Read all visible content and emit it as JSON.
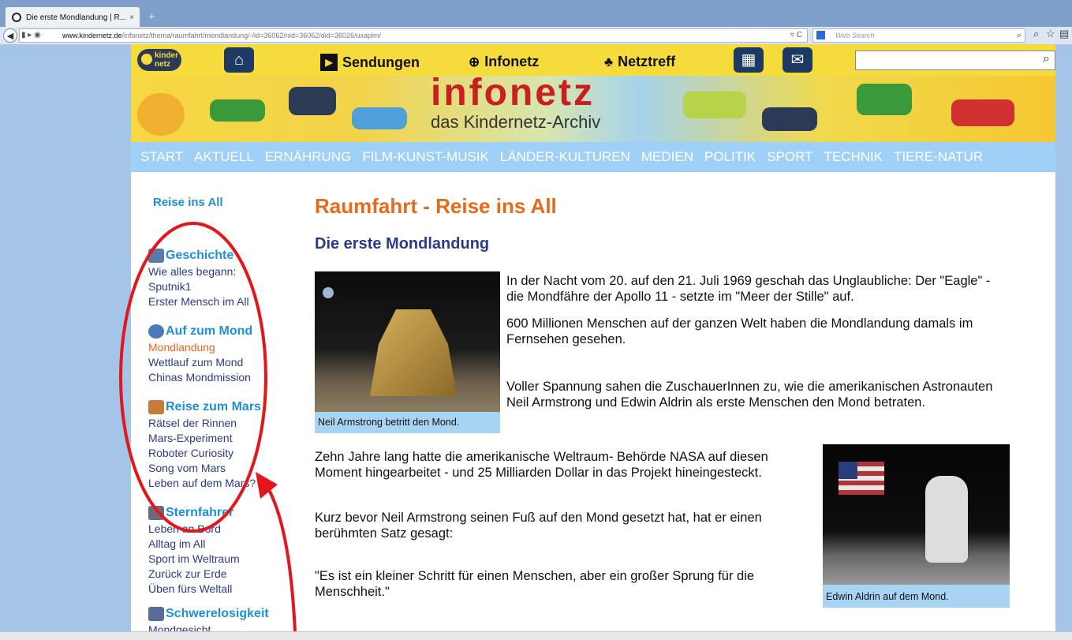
{
  "browser": {
    "tab_title": "Die erste Mondlandung | R...",
    "tab_close": "×",
    "new_tab": "+",
    "url_site": "◀ ▮ ▸",
    "url_domain": "www.kindernetz.de",
    "url_path": "/infonetz/thema/raumfahrt/mondlandung/-/id=36062/nid=36062/did=36026/uxaplm/",
    "reload_icon": "▿ C",
    "search_placeholder": "Web Search"
  },
  "site": {
    "logo": "kinder netz",
    "nav": {
      "sendungen": "Sendungen",
      "infonetz": "Infonetz",
      "netztreff": "Netztreff"
    },
    "banner_title": "infonetz",
    "banner_subtitle": "das Kindernetz-Archiv",
    "categories": [
      "START",
      "AKTUELL",
      "ERNÄHRUNG",
      "FILM-KUNST-MUSIK",
      "LÄNDER-KULTUREN",
      "MEDIEN",
      "POLITIK",
      "SPORT",
      "TECHNIK",
      "TIERE-NATUR"
    ]
  },
  "sidebar": {
    "heading": "Reise ins All",
    "groups": [
      {
        "title": "Geschichte",
        "items": [
          "Wie alles begann:",
          "Sputnik1",
          "Erster Mensch im All"
        ]
      },
      {
        "title": "Auf zum Mond",
        "items": [
          "Mondlandung",
          "Wettlauf zum Mond",
          "Chinas Mondmission"
        ]
      },
      {
        "title": "Reise zum Mars",
        "items": [
          "Rätsel der Rinnen",
          "Mars-Experiment",
          "Roboter Curiosity",
          "Song vom Mars",
          "Leben auf dem Mars?"
        ]
      },
      {
        "title": "Sternfahrer",
        "items": [
          "Leben an Bord",
          "Alltag im All",
          "Sport im Weltraum",
          "Zurück zur Erde",
          "Üben fürs Weltall"
        ]
      },
      {
        "title": "Schwerelosigkeit",
        "items": [
          "Mondgesicht"
        ]
      }
    ]
  },
  "content": {
    "title": "Raumfahrt - Reise ins All",
    "subtitle": "Die erste Mondlandung",
    "p1": "In der Nacht vom 20. auf den 21. Juli 1969 geschah das Unglaubliche: Der \"Eagle\" - die Mondfähre der Apollo 11 - setzte im \"Meer der Stille\" auf.",
    "p2": "600 Millionen Menschen auf der ganzen Welt haben die Mondlandung damals im Fernsehen gesehen.",
    "p3": "Voller Spannung sahen die ZuschauerInnen zu, wie die amerikanischen Astronauten Neil Armstrong und Edwin Aldrin als erste Menschen den Mond betraten.",
    "p4": "Zehn Jahre lang hatte die amerikanische Weltraum- Behörde NASA auf diesen Moment hingearbeitet - und 25 Milliarden Dollar in das Projekt hineingesteckt.",
    "p5": "Kurz bevor Neil Armstrong seinen Fuß auf den Mond gesetzt hat, hat er einen berühmten Satz gesagt:",
    "p6": "\"Es ist ein kleiner Schritt für einen Menschen, aber ein großer Sprung für die Menschheit.\"",
    "caption1": "Neil Armstrong betritt den Mond.",
    "caption2": "Edwin Aldrin auf dem Mond."
  },
  "colors": {
    "annotation": "#e3161b",
    "nav_bg": "#f5dc3c",
    "cat_bg": "#9fd0f7",
    "title": "#e56a1a",
    "link": "#2b3b8a"
  }
}
